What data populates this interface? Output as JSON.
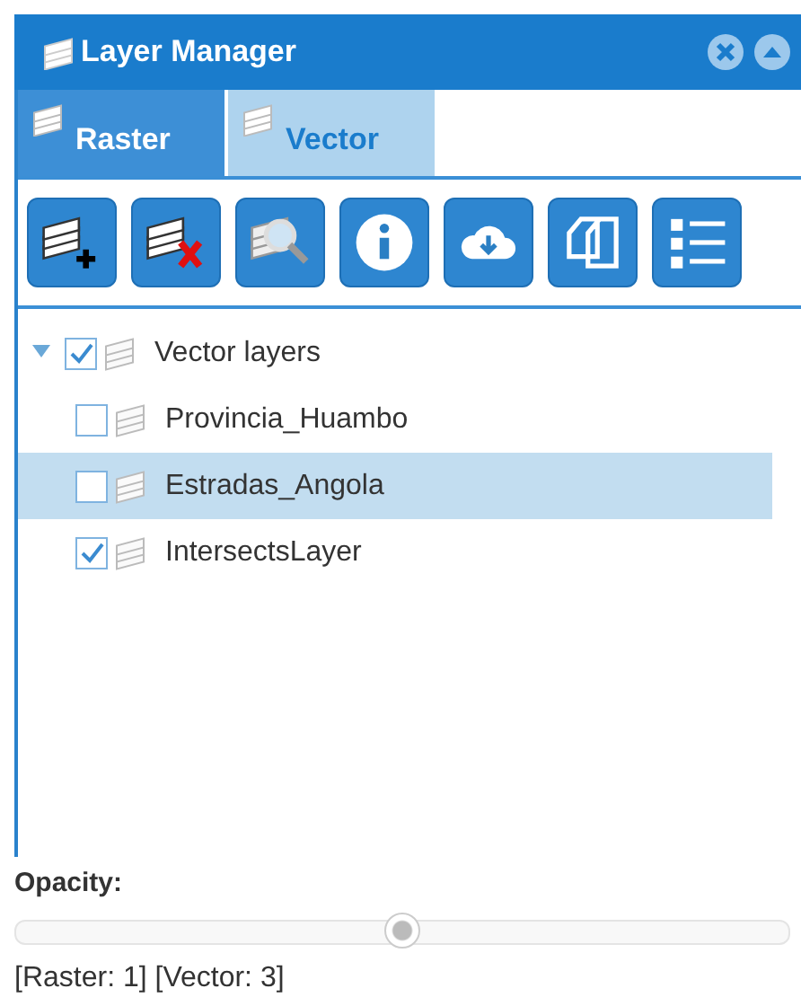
{
  "window": {
    "title": "Layer Manager"
  },
  "tabs": [
    {
      "label": "Raster",
      "selected": false
    },
    {
      "label": "Vector",
      "selected": true
    }
  ],
  "toolbar": [
    {
      "kind": "add"
    },
    {
      "kind": "remove"
    },
    {
      "kind": "zoom"
    },
    {
      "kind": "info"
    },
    {
      "kind": "download"
    },
    {
      "kind": "copy"
    },
    {
      "kind": "list"
    }
  ],
  "tree": [
    {
      "label": "Vector layers",
      "expanded": true,
      "checked": true,
      "selected": false,
      "children": [
        {
          "label": "Provincia_Huambo",
          "checked": false,
          "selected": false
        },
        {
          "label": "Estradas_Angola",
          "checked": false,
          "selected": true
        },
        {
          "label": "IntersectsLayer",
          "checked": true,
          "selected": false
        }
      ]
    }
  ],
  "opacity": {
    "label": "Opacity:",
    "level": 0.5
  },
  "status_bar": "[Raster: 1] [Vector: 3]"
}
